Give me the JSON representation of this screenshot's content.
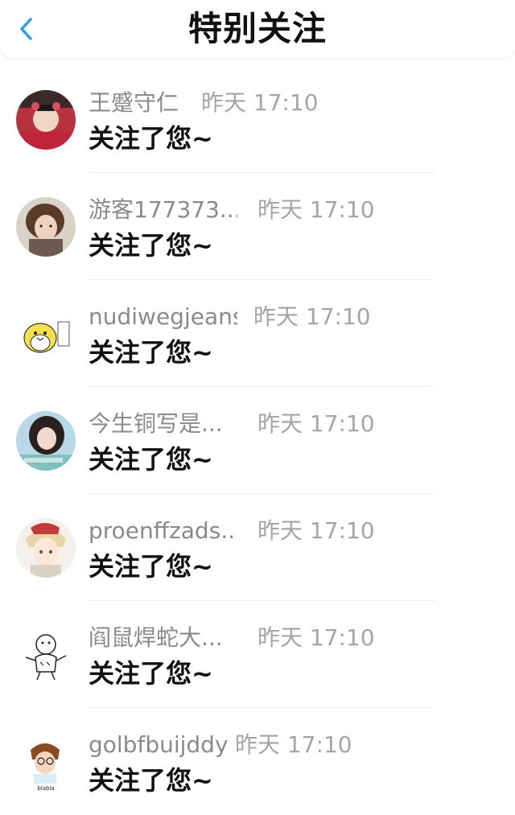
{
  "header": {
    "title": "特别关注",
    "back_icon": "chevron-left-icon",
    "accent_color": "#2f9bf2"
  },
  "items": [
    {
      "name": "王蹙守仁",
      "time": "昨天 17:10",
      "message": "关注了您~",
      "avatar": "avatar-opera"
    },
    {
      "name": "游客177373...",
      "time": "昨天 17:10",
      "message": "关注了您~",
      "avatar": "avatar-girl-curly-hair"
    },
    {
      "name": "nudiwegjeans",
      "time": "昨天 17:10",
      "message": "关注了您~",
      "avatar": "avatar-cartoon-bird"
    },
    {
      "name": "今生铜写是...",
      "time": "昨天 17:10",
      "message": "关注了您~",
      "avatar": "avatar-girl-photo"
    },
    {
      "name": "proenffzads...",
      "time": "昨天 17:10",
      "message": "关注了您~",
      "avatar": "avatar-anime-boy"
    },
    {
      "name": "阎鼠焊蛇大...",
      "time": "昨天 17:10",
      "message": "关注了您~",
      "avatar": "avatar-tiger-sketch"
    },
    {
      "name": "golbfbuijddy",
      "time": "昨天 17:10",
      "message": "关注了您~",
      "avatar": "avatar-glasses-girl"
    }
  ]
}
